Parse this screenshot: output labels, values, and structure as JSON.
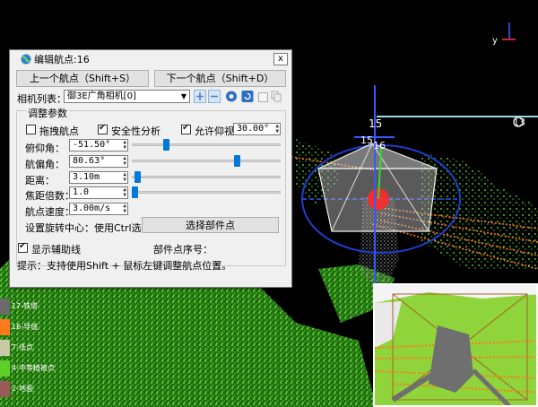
{
  "axis": {
    "y_label": "y"
  },
  "viewport_labels": {
    "waypoint_a": "15",
    "waypoint_b": "16",
    "waypoint_far": "13"
  },
  "legend": [
    {
      "label": "17-铁塔",
      "color": "#6b6b6b"
    },
    {
      "label": "16-导线",
      "color": "#ff7a1a"
    },
    {
      "label": "7-低点",
      "color": "#c9c9a6"
    },
    {
      "label": "4-中等植被点",
      "color": "#5fd02a"
    },
    {
      "label": "2-地面",
      "color": "#9b5a5a"
    }
  ],
  "dialog": {
    "title": "编辑航点:16",
    "close": "x",
    "prev_button": "上一个航点（Shift+S）",
    "next_button": "下一个航点（Shift+D）",
    "camera_label": "相机列表：",
    "camera_value": "御3E广角相机[0]",
    "group_title": "调整参数",
    "drag_label": "拖拽航点",
    "safety_label": "安全性分析",
    "allow_look_up_label": "允许仰视",
    "allow_look_up_value": "30.00°",
    "pitch_label": "俯仰角：",
    "pitch_value": "-51.50°",
    "pitch_level": 0.22,
    "yaw_label": "航偏角：",
    "yaw_value": "80.63°",
    "yaw_level": 0.72,
    "distance_label": "距离：",
    "distance_value": "3.10m",
    "distance_level": 0.02,
    "focal_label": "焦距倍数：",
    "focal_value": "1.0",
    "focal_level": 0.0,
    "speed_label": "航点速度：",
    "speed_value": "3.00m/s",
    "rotation_label": "设置旋转中心：使用Ctrl选点",
    "select_part_button": "选择部件点",
    "show_aux_label": "显示辅助线",
    "part_index_label": "部件点序号：",
    "hint": "提示：支持使用Shift + 鼠标左键调整航点位置。"
  }
}
